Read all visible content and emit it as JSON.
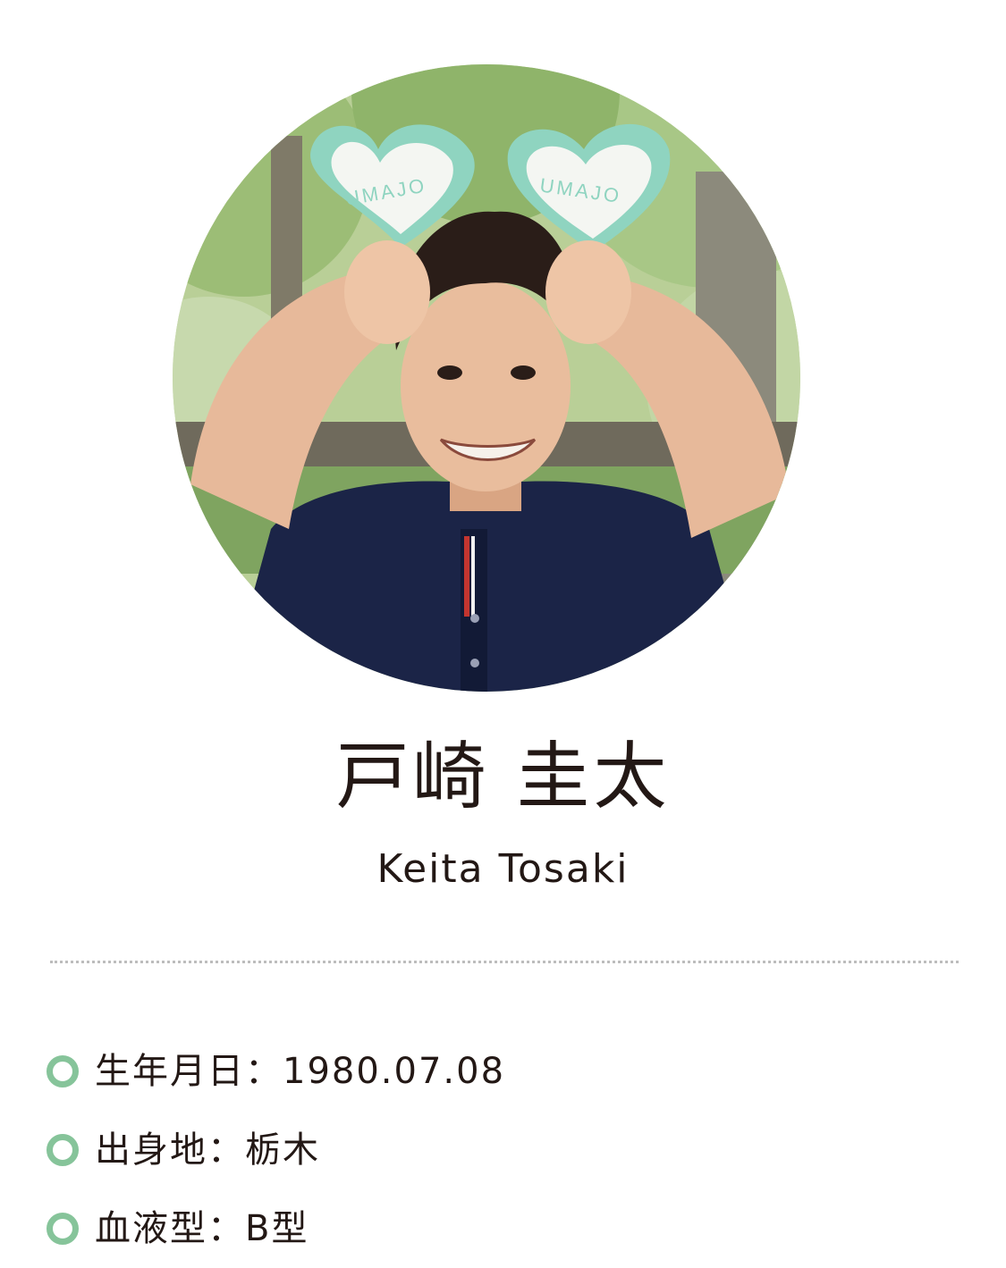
{
  "profile_photo": {
    "sign_text_left": "UMAJO",
    "sign_text_right": "UMAJO",
    "colors": {
      "sign_mint": "#8fd4c0",
      "shirt_navy": "#1b2447",
      "foliage": "#8fb46a"
    }
  },
  "name_jp": "戸崎 圭太",
  "name_en": "Keita Tosaki",
  "details": [
    {
      "label": "生年月日：1980.07.08",
      "bullet_icon": "ring-bullet-icon"
    },
    {
      "label": "出身地：栃木",
      "bullet_icon": "ring-bullet-icon"
    },
    {
      "label": "血液型：B型",
      "bullet_icon": "ring-bullet-icon"
    }
  ],
  "accent_color": "#86c49a"
}
